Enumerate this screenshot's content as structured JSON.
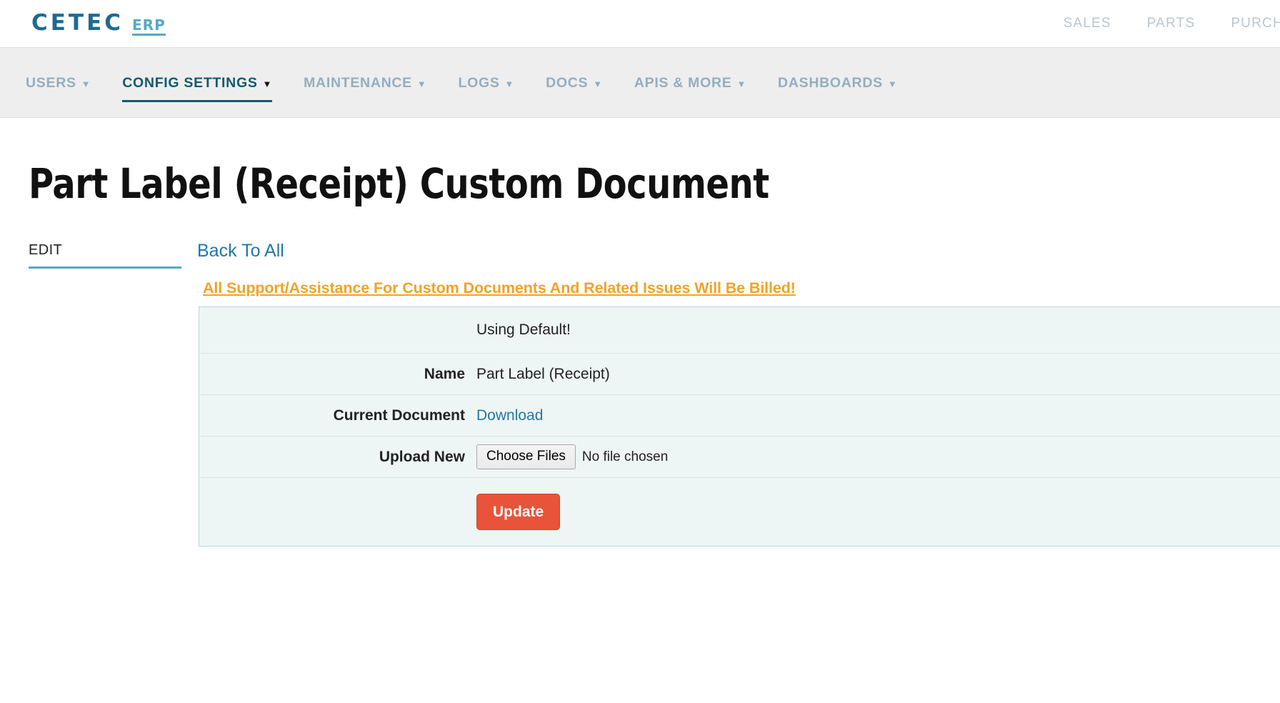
{
  "brand": {
    "name": "CETEC",
    "suffix": "ERP"
  },
  "topnav": {
    "items": [
      {
        "label": "SALES"
      },
      {
        "label": "PARTS"
      },
      {
        "label": "PURCHASING"
      }
    ]
  },
  "subnav": {
    "items": [
      {
        "label": "USERS",
        "caret": "▼",
        "active": false
      },
      {
        "label": "CONFIG SETTINGS",
        "caret": "▼",
        "active": true
      },
      {
        "label": "MAINTENANCE",
        "caret": "▼",
        "active": false
      },
      {
        "label": "LOGS",
        "caret": "▼",
        "active": false
      },
      {
        "label": "DOCS",
        "caret": "▼",
        "active": false
      },
      {
        "label": "APIS & MORE",
        "caret": "▼",
        "active": false
      },
      {
        "label": "DASHBOARDS",
        "caret": "▼",
        "active": false
      }
    ]
  },
  "page": {
    "title": "Part Label (Receipt) Custom Document"
  },
  "tabs": {
    "edit_label": "EDIT"
  },
  "actions": {
    "back_to_all": "Back To All",
    "billing_warning": "All Support/Assistance For Custom Documents And Related Issues Will Be Billed!"
  },
  "document": {
    "status": "Using Default!",
    "rows": [
      {
        "label": "Name",
        "value": "Part Label (Receipt)"
      },
      {
        "label": "Current Document",
        "value": "Download"
      },
      {
        "label": "Upload New",
        "value": ""
      }
    ],
    "name_label": "Name",
    "name_value": "Part Label (Receipt)",
    "current_document_label": "Current Document",
    "download_label": "Download",
    "upload_label": "Upload New",
    "choose_files_label": "Choose Files",
    "file_status": "No file chosen",
    "update_label": "Update"
  },
  "colors": {
    "brand_dark": "#1f6a92",
    "brand_light": "#56a8c7",
    "active_nav": "#15596f",
    "link": "#2177a8",
    "warning": "#f2a229",
    "panel_bg": "#eef5f5",
    "panel_border": "#bcd7dd",
    "update_button": "#e8533a",
    "tab_underline": "#5aa9bd"
  }
}
